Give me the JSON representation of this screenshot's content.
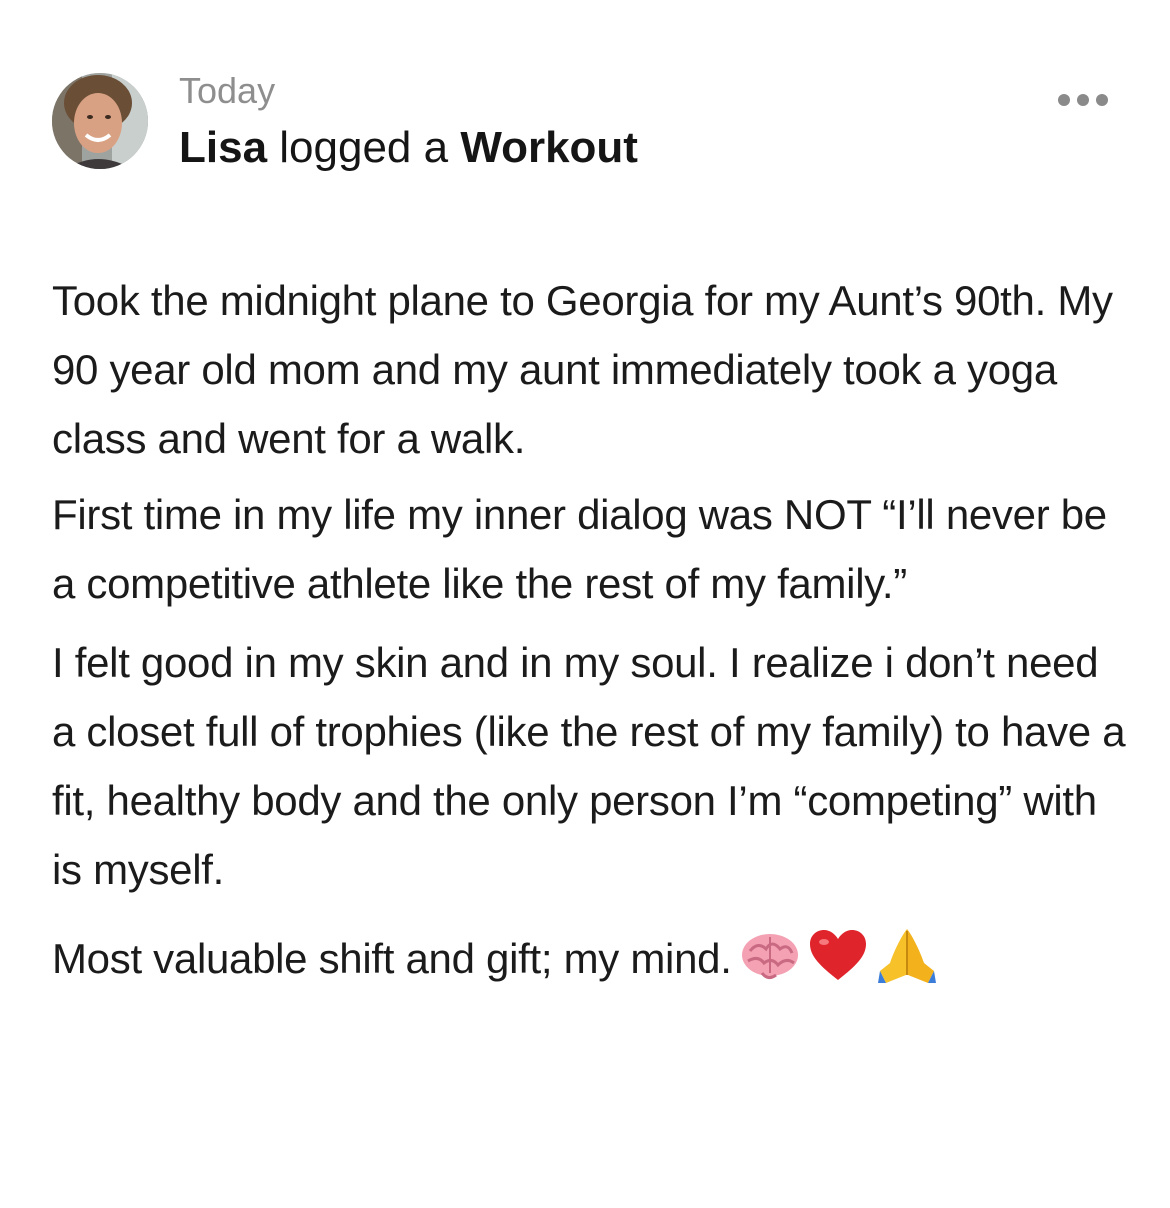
{
  "post": {
    "timestamp": "Today",
    "author": "Lisa",
    "action_text": " logged a ",
    "activity": "Workout",
    "paragraphs": [
      "Took the midnight plane to Georgia for my Aunt’s 90th. My 90 year old mom and my aunt immediately took a yoga class and went for a walk.",
      "First time in my life my inner dialog was NOT “I’ll never be a competitive athlete like the rest of my family.”",
      "I felt good in my skin and in my soul. I realize i don’t need a closet full of trophies (like the rest of my family) to have a fit, healthy body and the only person I’m “competing” with is myself.",
      "Most valuable shift and gift;  my mind."
    ],
    "emojis": [
      "brain-icon",
      "red-heart-icon",
      "folded-hands-icon"
    ]
  },
  "colors": {
    "text": "#1b1b1b",
    "timestamp": "#8e8e8e",
    "more_dots": "#8a8a8a",
    "heart": "#e0242c",
    "brain": "#f3a1b3",
    "hands": "#f7c12a"
  }
}
